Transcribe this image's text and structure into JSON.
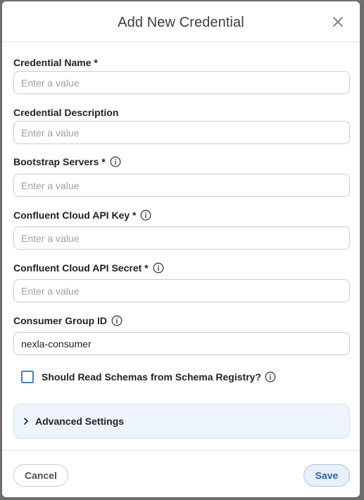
{
  "dialog": {
    "title": "Add New Credential"
  },
  "fields": {
    "credential_name": {
      "label": "Credential Name *",
      "placeholder": "Enter a value",
      "value": ""
    },
    "credential_description": {
      "label": "Credential Description",
      "placeholder": "Enter a value",
      "value": ""
    },
    "bootstrap_servers": {
      "label": "Bootstrap Servers *",
      "placeholder": "Enter a value",
      "value": ""
    },
    "api_key": {
      "label": "Confluent Cloud API Key *",
      "placeholder": "Enter a value",
      "value": ""
    },
    "api_secret": {
      "label": "Confluent Cloud API Secret *",
      "placeholder": "Enter a value",
      "value": ""
    },
    "consumer_group_id": {
      "label": "Consumer Group ID",
      "placeholder": "",
      "value": "nexla-consumer"
    }
  },
  "schema_registry": {
    "label": "Should Read Schemas from Schema Registry?",
    "checked": false
  },
  "advanced": {
    "label": "Advanced Settings",
    "expanded": false
  },
  "footer": {
    "cancel_label": "Cancel",
    "save_label": "Save"
  },
  "colors": {
    "accent": "#2b5fb8",
    "checkbox_border": "#4a7cd6",
    "advanced_bg": "#eef4fc"
  },
  "icons": {
    "close": "close-icon",
    "info": "info-icon",
    "chevron": "chevron-right-icon"
  }
}
